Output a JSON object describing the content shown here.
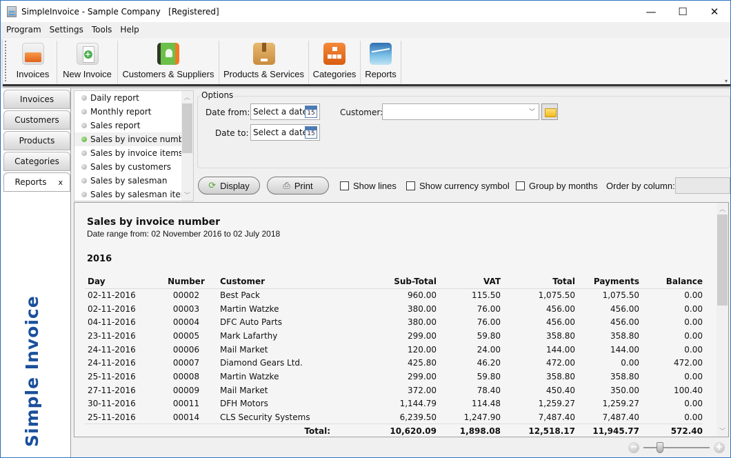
{
  "window": {
    "title": "SimpleInvoice - Sample Company   [Registered]",
    "controls": {
      "minimize": "—",
      "maximize": "☐",
      "close": "✕"
    }
  },
  "menu": [
    "Program",
    "Settings",
    "Tools",
    "Help"
  ],
  "toolbar": {
    "buttons": [
      {
        "label": "Invoices",
        "icon": "invoices-folder-icon"
      },
      {
        "label": "New Invoice",
        "icon": "new-invoice-icon"
      },
      {
        "label": "Customers & Suppliers",
        "icon": "address-book-icon"
      },
      {
        "label": "Products & Services",
        "icon": "package-box-icon"
      },
      {
        "label": "Categories",
        "icon": "hierarchy-icon"
      },
      {
        "label": "Reports",
        "icon": "chart-report-icon"
      }
    ],
    "overflow": "▾"
  },
  "nav_tabs": [
    {
      "label": "Invoices",
      "active": false
    },
    {
      "label": "Customers",
      "active": false
    },
    {
      "label": "Products",
      "active": false
    },
    {
      "label": "Categories",
      "active": false
    },
    {
      "label": "Reports",
      "active": true,
      "close": "x"
    }
  ],
  "brand": "Simple Invoice",
  "reports": {
    "items": [
      {
        "label": "Daily report",
        "selected": false
      },
      {
        "label": "Monthly report",
        "selected": false
      },
      {
        "label": "Sales report",
        "selected": false
      },
      {
        "label": "Sales by invoice number",
        "selected": true
      },
      {
        "label": "Sales by invoice items",
        "selected": false
      },
      {
        "label": "Sales by customers",
        "selected": false
      },
      {
        "label": "Sales by salesman",
        "selected": false
      },
      {
        "label": "Sales by salesman items",
        "selected": false
      }
    ]
  },
  "options": {
    "legend": "Options",
    "date_from_label": "Date from:",
    "date_to_label": "Date to:",
    "date_from_value": "Select a date",
    "date_to_value": "Select a date",
    "calendar_day": "15",
    "customer_label": "Customer:",
    "customer_value": ""
  },
  "actions": {
    "display_label": "Display",
    "print_label": "Print",
    "show_lines_label": "Show lines",
    "show_lines_checked": false,
    "show_currency_label": "Show currency symbol",
    "show_currency_checked": false,
    "group_months_label": "Group by months",
    "group_months_checked": false,
    "order_label": "Order by column:",
    "order_value": ""
  },
  "report": {
    "title": "Sales by invoice number",
    "range": "Date range from: 02 November 2016 to 02 July 2018",
    "year": "2016",
    "columns": [
      "Day",
      "Number",
      "Customer",
      "Sub-Total",
      "VAT",
      "Total",
      "Payments",
      "Balance"
    ],
    "rows": [
      [
        "02-11-2016",
        "00002",
        "Best Pack",
        "960.00",
        "115.50",
        "1,075.50",
        "1,075.50",
        "0.00"
      ],
      [
        "02-11-2016",
        "00003",
        "Martin Watzke",
        "380.00",
        "76.00",
        "456.00",
        "456.00",
        "0.00"
      ],
      [
        "04-11-2016",
        "00004",
        "DFC Auto Parts",
        "380.00",
        "76.00",
        "456.00",
        "456.00",
        "0.00"
      ],
      [
        "23-11-2016",
        "00005",
        "Mark Lafarthy",
        "299.00",
        "59.80",
        "358.80",
        "358.80",
        "0.00"
      ],
      [
        "24-11-2016",
        "00006",
        "Mail Market",
        "120.00",
        "24.00",
        "144.00",
        "144.00",
        "0.00"
      ],
      [
        "24-11-2016",
        "00007",
        "Diamond Gears Ltd.",
        "425.80",
        "46.20",
        "472.00",
        "0.00",
        "472.00"
      ],
      [
        "25-11-2016",
        "00008",
        "Martin Watzke",
        "299.00",
        "59.80",
        "358.80",
        "358.80",
        "0.00"
      ],
      [
        "27-11-2016",
        "00009",
        "Mail Market",
        "372.00",
        "78.40",
        "450.40",
        "350.00",
        "100.40"
      ],
      [
        "30-11-2016",
        "00011",
        "DFH Motors",
        "1,144.79",
        "114.48",
        "1,259.27",
        "1,259.27",
        "0.00"
      ],
      [
        "25-11-2016",
        "00014",
        "CLS Security Systems",
        "6,239.50",
        "1,247.90",
        "7,487.40",
        "7,487.40",
        "0.00"
      ]
    ],
    "total": {
      "label": "Total:",
      "sub_total": "10,620.09",
      "vat": "1,898.08",
      "total": "12,518.17",
      "payments": "11,945.77",
      "balance": "572.40"
    }
  },
  "zoom": {
    "minus": "−",
    "plus": "+",
    "level_fraction": 0.25
  }
}
